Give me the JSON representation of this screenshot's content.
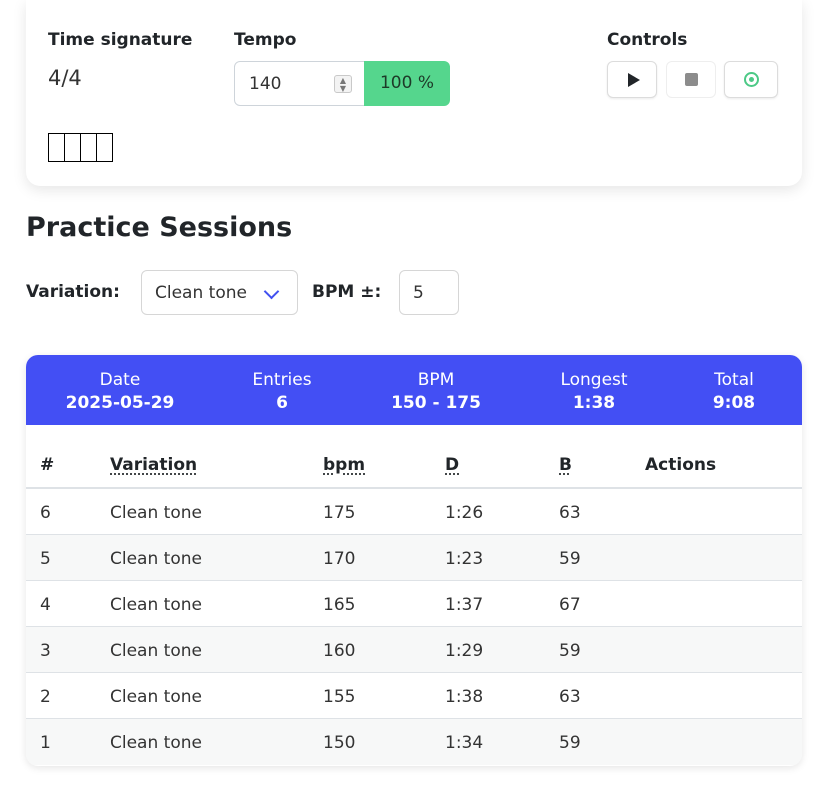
{
  "metronome": {
    "time_signature_label": "Time signature",
    "time_signature_value": "4/4",
    "tempo_label": "Tempo",
    "tempo_value": "140",
    "tempo_percent": "100 %",
    "controls_label": "Controls",
    "controls": [
      {
        "name": "play",
        "icon": "play-icon"
      },
      {
        "name": "stop",
        "icon": "stop-icon"
      },
      {
        "name": "tap",
        "icon": "target-icon"
      }
    ]
  },
  "practice": {
    "title": "Practice Sessions",
    "variation_label": "Variation:",
    "variation_selected": "Clean tone",
    "bpm_label": "BPM ±:",
    "bpm_value": "5"
  },
  "summary": {
    "date": {
      "label": "Date",
      "value": "2025-05-29"
    },
    "entries": {
      "label": "Entries",
      "value": "6"
    },
    "bpm": {
      "label": "BPM",
      "value": "150 - 175"
    },
    "longest": {
      "label": "Longest",
      "value": "1:38"
    },
    "total": {
      "label": "Total",
      "value": "9:08"
    }
  },
  "table": {
    "headers": [
      "#",
      "Variation",
      "bpm",
      "D",
      "B",
      "Actions"
    ],
    "rows": [
      [
        "6",
        "Clean tone",
        "175",
        "1:26",
        "63"
      ],
      [
        "5",
        "Clean tone",
        "170",
        "1:23",
        "59"
      ],
      [
        "4",
        "Clean tone",
        "165",
        "1:37",
        "67"
      ],
      [
        "3",
        "Clean tone",
        "160",
        "1:29",
        "59"
      ],
      [
        "2",
        "Clean tone",
        "155",
        "1:38",
        "63"
      ],
      [
        "1",
        "Clean tone",
        "150",
        "1:34",
        "59"
      ]
    ]
  },
  "colors": {
    "accent": "#434ff4",
    "tempo_badge": "#55d68d",
    "tap_icon": "#4cc986"
  }
}
